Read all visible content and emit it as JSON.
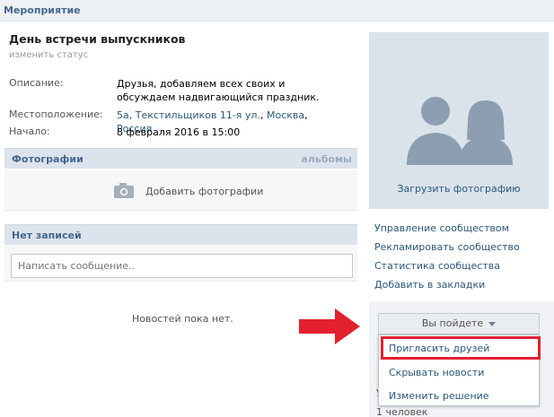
{
  "header": {
    "title": "Мероприятие"
  },
  "event": {
    "title": "День встречи выпускников",
    "change_status": "изменить статус",
    "description_label": "Описание:",
    "description_value": "Друзья, добавляем всех своих и обсуждаем надвигающийся праздник.",
    "location_label": "Местоположение:",
    "location_street": "5а, Текстильщиков 11-я ул.",
    "location_city": "Москва",
    "location_country": "Россия",
    "start_label": "Начало:",
    "start_value": "8 февраля 2016 в 15:00"
  },
  "photos": {
    "header": "Фотографии",
    "albums_link": "альбомы",
    "add_label": "Добавить фотографии"
  },
  "wall": {
    "header": "Нет записей",
    "input_placeholder": "Написать сообщение..",
    "no_news": "Новостей пока нет."
  },
  "sidebar": {
    "upload_photo": "Загрузить фотографию",
    "links": [
      {
        "label": "Управление сообществом"
      },
      {
        "label": "Рекламировать сообщество"
      },
      {
        "label": "Статистика сообщества"
      },
      {
        "label": "Добавить в закладки"
      }
    ],
    "join_button": "Вы пойдете",
    "menu": [
      {
        "label": "Пригласить друзей"
      },
      {
        "label": "Скрывать новости"
      },
      {
        "label": "Изменить решение"
      }
    ],
    "side_mark": "У",
    "members_count": "1 человек"
  },
  "colors": {
    "link": "#2b587a",
    "header_text": "#45688e",
    "highlight": "#e3202e",
    "avatar_bg": "#dae2ea",
    "silhouette": "#8d9eb2"
  },
  "icons": {
    "camera": "camera-icon",
    "avatar": "community-avatar-placeholder",
    "arrow": "red-arrow-pointer",
    "caret": "caret-down-icon"
  }
}
